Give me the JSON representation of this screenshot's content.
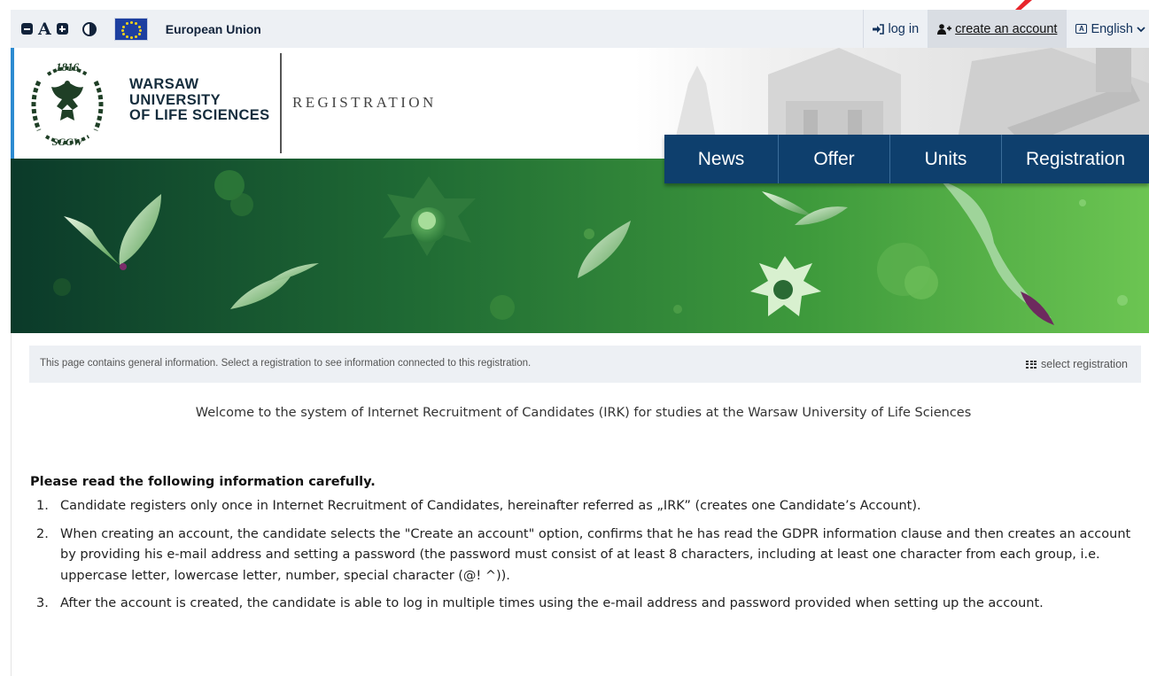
{
  "topbar": {
    "eu_label": "European Union",
    "login_label": "log in",
    "create_account_label": "create an account",
    "language_label": "English"
  },
  "header": {
    "university_name_line1": "WARSAW",
    "university_name_line2": "UNIVERSITY",
    "university_name_line3": "OF LIFE SCIENCES",
    "section_label": "REGISTRATION",
    "seal_year": "1816",
    "seal_abbrev": "SGGW"
  },
  "nav": {
    "items": [
      {
        "label": "News"
      },
      {
        "label": "Offer"
      },
      {
        "label": "Units"
      },
      {
        "label": "Registration"
      }
    ]
  },
  "infobar": {
    "text": "This page contains general information. Select a registration to see information connected to this registration.",
    "select_label": "select registration"
  },
  "main": {
    "welcome": "Welcome to the system of Internet Recruitment of Candidates (IRK) for studies at the Warsaw University of Life Sciences",
    "heading": "Please read the following information carefully.",
    "items": [
      {
        "num": "1.",
        "text": "Candidate registers only once in Internet Recruitment of Candidates, hereinafter referred as „IRK” (creates one Candidate’s Account)."
      },
      {
        "num": "2.",
        "text": "When creating an account, the candidate selects the \"Create an account\" option, confirms that he has read the GDPR information clause and then creates an account by providing his e-mail address and setting a password (the password must consist of at least 8 characters, including at least one character from each group, i.e. uppercase letter, lowercase letter, number, special character (@! ^))."
      },
      {
        "num": "3.",
        "text": "After the account is created, the candidate is able to log in multiple times using the e-mail address and password provided when setting up the account."
      }
    ]
  },
  "icons": {
    "decrease_font": "minus-square-icon",
    "font_size": "font-a-icon",
    "increase_font": "plus-square-icon",
    "contrast": "contrast-icon",
    "eu_flag": "eu-flag-icon",
    "login": "sign-in-icon",
    "create_account": "user-plus-icon",
    "language": "language-icon",
    "chevron": "chevron-down-icon",
    "select_registration": "grid-icon"
  },
  "colors": {
    "nav_bg": "#0e3f6d",
    "banner_dark": "#0b3a2a",
    "banner_light": "#6cc552",
    "accent": "#2d8bd1",
    "topbar_bg": "#edf0f4"
  }
}
